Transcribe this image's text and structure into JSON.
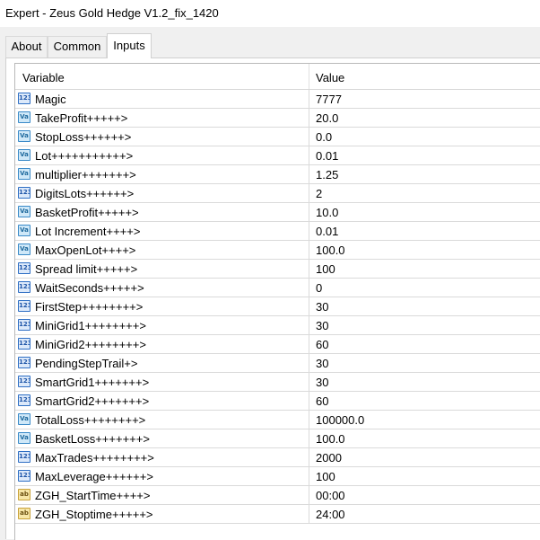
{
  "window": {
    "title": "Expert - Zeus Gold Hedge V1.2_fix_1420"
  },
  "tabs": [
    {
      "label": "About"
    },
    {
      "label": "Common"
    },
    {
      "label": "Inputs"
    }
  ],
  "table": {
    "headers": {
      "variable": "Variable",
      "value": "Value"
    },
    "rows": [
      {
        "icon": "int",
        "icon_label": "123",
        "name": "Magic",
        "value": "7777"
      },
      {
        "icon": "dbl",
        "icon_label": "Va",
        "name": "TakeProfit+++++>",
        "value": "20.0"
      },
      {
        "icon": "dbl",
        "icon_label": "Va",
        "name": "StopLoss++++++>",
        "value": "0.0"
      },
      {
        "icon": "dbl",
        "icon_label": "Va",
        "name": "Lot+++++++++++>",
        "value": "0.01"
      },
      {
        "icon": "dbl",
        "icon_label": "Va",
        "name": "multiplier+++++++>",
        "value": "1.25"
      },
      {
        "icon": "int",
        "icon_label": "123",
        "name": "DigitsLots++++++>",
        "value": "2"
      },
      {
        "icon": "dbl",
        "icon_label": "Va",
        "name": "BasketProfit+++++>",
        "value": "10.0"
      },
      {
        "icon": "dbl",
        "icon_label": "Va",
        "name": "Lot Increment++++>",
        "value": "0.01"
      },
      {
        "icon": "dbl",
        "icon_label": "Va",
        "name": "MaxOpenLot++++>",
        "value": "100.0"
      },
      {
        "icon": "int",
        "icon_label": "123",
        "name": "Spread limit+++++>",
        "value": "100"
      },
      {
        "icon": "int",
        "icon_label": "123",
        "name": "WaitSeconds+++++>",
        "value": "0"
      },
      {
        "icon": "int",
        "icon_label": "123",
        "name": "FirstStep++++++++>",
        "value": "30"
      },
      {
        "icon": "int",
        "icon_label": "123",
        "name": "MiniGrid1++++++++>",
        "value": "30"
      },
      {
        "icon": "int",
        "icon_label": "123",
        "name": "MiniGrid2++++++++>",
        "value": "60"
      },
      {
        "icon": "int",
        "icon_label": "123",
        "name": "PendingStepTrail+>",
        "value": "30"
      },
      {
        "icon": "int",
        "icon_label": "123",
        "name": "SmartGrid1+++++++>",
        "value": "30"
      },
      {
        "icon": "int",
        "icon_label": "123",
        "name": "SmartGrid2+++++++>",
        "value": "60"
      },
      {
        "icon": "dbl",
        "icon_label": "Va",
        "name": "TotalLoss++++++++>",
        "value": "100000.0"
      },
      {
        "icon": "dbl",
        "icon_label": "Va",
        "name": "BasketLoss+++++++>",
        "value": "100.0"
      },
      {
        "icon": "int",
        "icon_label": "123",
        "name": "MaxTrades++++++++>",
        "value": "2000"
      },
      {
        "icon": "int",
        "icon_label": "123",
        "name": "MaxLeverage++++++>",
        "value": "100"
      },
      {
        "icon": "str",
        "icon_label": "ab",
        "name": "ZGH_StartTime++++>",
        "value": "00:00"
      },
      {
        "icon": "str",
        "icon_label": "ab",
        "name": "ZGH_Stoptime+++++>",
        "value": "24:00"
      }
    ]
  }
}
